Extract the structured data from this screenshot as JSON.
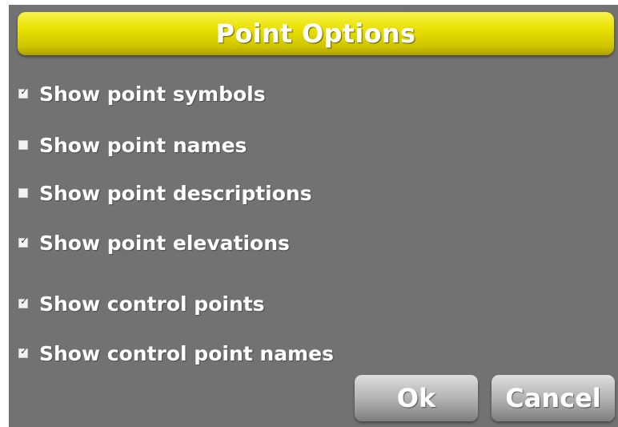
{
  "dialog": {
    "title": "Point Options"
  },
  "options": [
    {
      "label": "Show point symbols",
      "checked": true
    },
    {
      "label": "Show point names",
      "checked": false
    },
    {
      "label": "Show point descriptions",
      "checked": false
    },
    {
      "label": "Show point elevations",
      "checked": true
    },
    {
      "label": "Show control points",
      "checked": true
    },
    {
      "label": "Show control point names",
      "checked": true
    }
  ],
  "buttons": {
    "ok_label": "Ok",
    "cancel_label": "Cancel"
  },
  "colors": {
    "title_bar": "#e9e100",
    "panel_background": "#727272",
    "button": "#b8b8b8"
  }
}
